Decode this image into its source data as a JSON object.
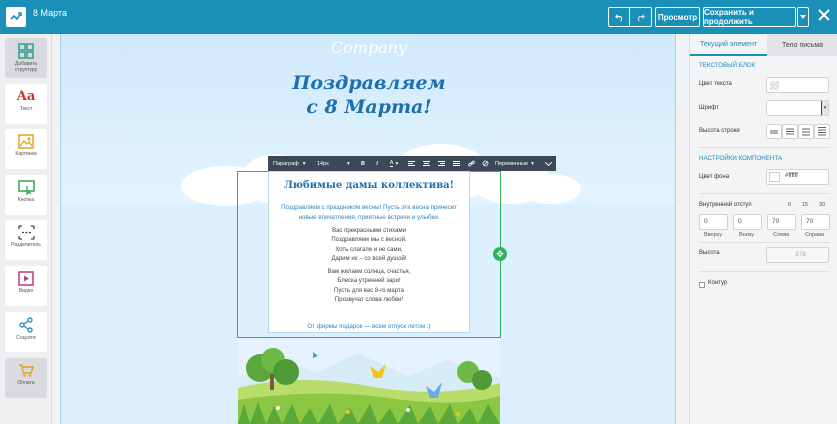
{
  "topbar": {
    "title": "8 Марта",
    "preview_label": "Просмотр",
    "save_label": "Сохранить и продолжить"
  },
  "sidebar": {
    "items": [
      {
        "label": "Добавить структуру",
        "icon": "grid-icon"
      },
      {
        "label": "Текст",
        "icon": "text-icon"
      },
      {
        "label": "Картинка",
        "icon": "image-icon"
      },
      {
        "label": "Кнопка",
        "icon": "button-icon"
      },
      {
        "label": "Разделитель",
        "icon": "divider-icon"
      },
      {
        "label": "Видео",
        "icon": "video-icon"
      },
      {
        "label": "Соцсети",
        "icon": "share-icon"
      },
      {
        "label": "Оплата",
        "icon": "cart-icon"
      }
    ]
  },
  "email": {
    "logo": "Company",
    "headline_1": "Поздравляем",
    "headline_2": "с 8 Марта!",
    "block_title": "Любимые дамы коллектива!",
    "intro_1": "Поздравляем с праздником весны! Пусть эта весна принесет",
    "intro_2": "новые впечатления, приятные встречи и улыбки.",
    "poem": [
      "Вас прекрасными стихами",
      "Поздравляем мы с весной.",
      "Хоть слагали и не сами,",
      "Дарим их – со всей душой!",
      "",
      "Вам желаем солнца, счастья,",
      "Блеска утренней зари!",
      "Пусть для вас 8-го марта",
      "Прозвучат слова любви!"
    ],
    "footer_text": "От фирмы подарок — всем отпуск летом :)"
  },
  "format_toolbar": {
    "paragraph": "Параграф",
    "font_size": "14px",
    "variables": "Переменные"
  },
  "right_panel": {
    "tab_current": "Текущий элемент",
    "tab_body": "Тело письма",
    "section_text_block": "ТЕКСТОВЫЙ БЛОК",
    "text_color_label": "Цвет текста",
    "font_label": "Шрифт",
    "line_height_label": "Высота строки",
    "section_component": "НАСТРОЙКИ КОМПОНЕНТА",
    "bg_color_label": "Цвет фона",
    "bg_color_value": "#ffffff",
    "padding_label": "Внутренний отступ",
    "padding_presets": [
      "0",
      "15",
      "30"
    ],
    "padding_values": {
      "top": "0",
      "bottom": "0",
      "left": "70",
      "right": "70"
    },
    "padding_labels": {
      "top": "Вверху",
      "bottom": "Внизу",
      "left": "Слева",
      "right": "Справа"
    },
    "height_label": "Высота",
    "height_value": "378",
    "border_label": "Контур"
  },
  "colors": {
    "brand": "#1a8fb8",
    "selection": "#2fb35a",
    "headline": "#1d6fb0",
    "delete": "#e05a5a"
  }
}
